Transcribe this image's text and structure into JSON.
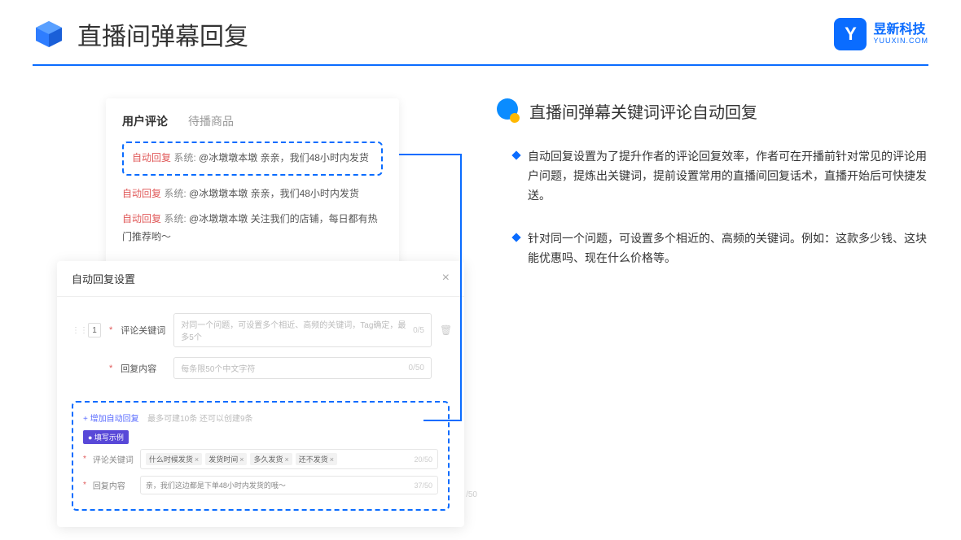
{
  "header": {
    "title": "直播间弹幕回复",
    "logo_cn": "昱新科技",
    "logo_en": "YUUXIN.COM",
    "logo_letter": "Y"
  },
  "comments": {
    "tab_active": "用户评论",
    "tab_other": "待播商品",
    "highlighted": {
      "tag": "自动回复",
      "sys": "系统:",
      "text": "@冰墩墩本墩 亲亲，我们48小时内发货"
    },
    "item2": {
      "tag": "自动回复",
      "sys": "系统:",
      "text": "@冰墩墩本墩 亲亲，我们48小时内发货"
    },
    "item3": {
      "tag": "自动回复",
      "sys": "系统:",
      "text": "@冰墩墩本墩 关注我们的店铺，每日都有热门推荐哟～"
    }
  },
  "modal": {
    "title": "自动回复设置",
    "order": "1",
    "keyword_label": "评论关键词",
    "keyword_placeholder": "对同一个问题，可设置多个相近、高频的关键词，Tag确定，最多5个",
    "keyword_count": "0/5",
    "content_label": "回复内容",
    "content_placeholder": "每条限50个中文字符",
    "content_count": "0/50",
    "add_text": "+ 增加自动回复",
    "add_hint": "最多可建10条 还可以创建9条",
    "example_badge": "● 填写示例",
    "ex_keyword_label": "评论关键词",
    "ex_tags": [
      "什么时候发货",
      "发货时间",
      "多久发货",
      "还不发货"
    ],
    "ex_keyword_count": "20/50",
    "ex_content_label": "回复内容",
    "ex_content_text": "亲，我们这边都是下单48小时内发货的哦～",
    "ex_content_count": "37/50",
    "side_count": "/50"
  },
  "section": {
    "title": "直播间弹幕关键词评论自动回复",
    "bullet1": "自动回复设置为了提升作者的评论回复效率，作者可在开播前针对常见的评论用户问题，提炼出关键词，提前设置常用的直播间回复话术，直播开始后可快捷发送。",
    "bullet2": "针对同一个问题，可设置多个相近的、高频的关键词。例如：这款多少钱、这块能优惠吗、现在什么价格等。"
  }
}
